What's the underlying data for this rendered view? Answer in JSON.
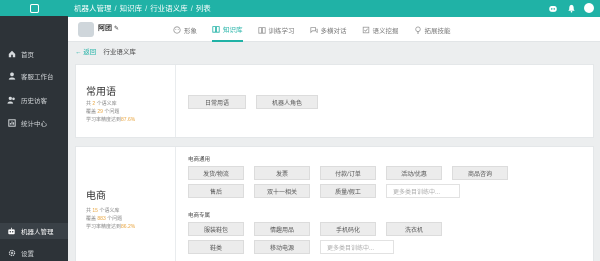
{
  "topbar": {
    "crumbs": [
      "机器人管理",
      "知识库",
      "行业语义库",
      "列表"
    ]
  },
  "sidebar": {
    "items": [
      {
        "label": "首页",
        "icon": "home-icon"
      },
      {
        "label": "客服工作台",
        "icon": "user-icon"
      },
      {
        "label": "历史访客",
        "icon": "people-icon"
      },
      {
        "label": "统计中心",
        "icon": "chart-icon"
      },
      {
        "label": "机器人管理",
        "icon": "robot-icon"
      },
      {
        "label": "设置",
        "icon": "gear-icon"
      }
    ]
  },
  "robot": {
    "name": "阿团"
  },
  "tabs": [
    {
      "label": "形象",
      "icon": "face-icon"
    },
    {
      "label": "知识库",
      "icon": "book-icon"
    },
    {
      "label": "训练学习",
      "icon": "training-icon"
    },
    {
      "label": "多横对话",
      "icon": "dialog-icon"
    },
    {
      "label": "语义挖掘",
      "icon": "mining-icon"
    },
    {
      "label": "拓展技能",
      "icon": "bulb-icon"
    }
  ],
  "backrow": {
    "back": "← 返回",
    "title": "行业语义库"
  },
  "cards": {
    "common": {
      "title": "常用语",
      "stat1_pre": "共",
      "stat1_num": "2",
      "stat1_post": "个语义库",
      "stat2_pre": "覆盖",
      "stat2_num": "29",
      "stat2_post": "个问题",
      "stat3_pre": "学习率精度达到",
      "stat3_num": "87.6%",
      "chips": [
        "日常用语",
        "机器人角色"
      ]
    },
    "ecommerce": {
      "title": "电商",
      "stat1_pre": "共",
      "stat1_num": "15",
      "stat1_post": "个语义库",
      "stat2_pre": "覆盖",
      "stat2_num": "883",
      "stat2_post": "个问题",
      "stat3_pre": "学习率精度达到",
      "stat3_num": "86.2%",
      "group1": "电商通用",
      "group1_chips": [
        "发货/物流",
        "发票",
        "付款/订单",
        "活动/优惠",
        "商品咨询",
        "售后",
        "双十一相关",
        "质量/假工"
      ],
      "group1_more": "更多类目训练中...",
      "group2": "电商专属",
      "group2_chips": [
        "服装鞋包",
        "情趣用品",
        "手机码化",
        "洗衣机",
        "鞋类",
        "移动电源"
      ],
      "group2_more": "更多类目训练中..."
    }
  },
  "colors": {
    "accent": "#20b2a6",
    "sidebar": "#2d3338",
    "highlight": "#e8a33b"
  }
}
